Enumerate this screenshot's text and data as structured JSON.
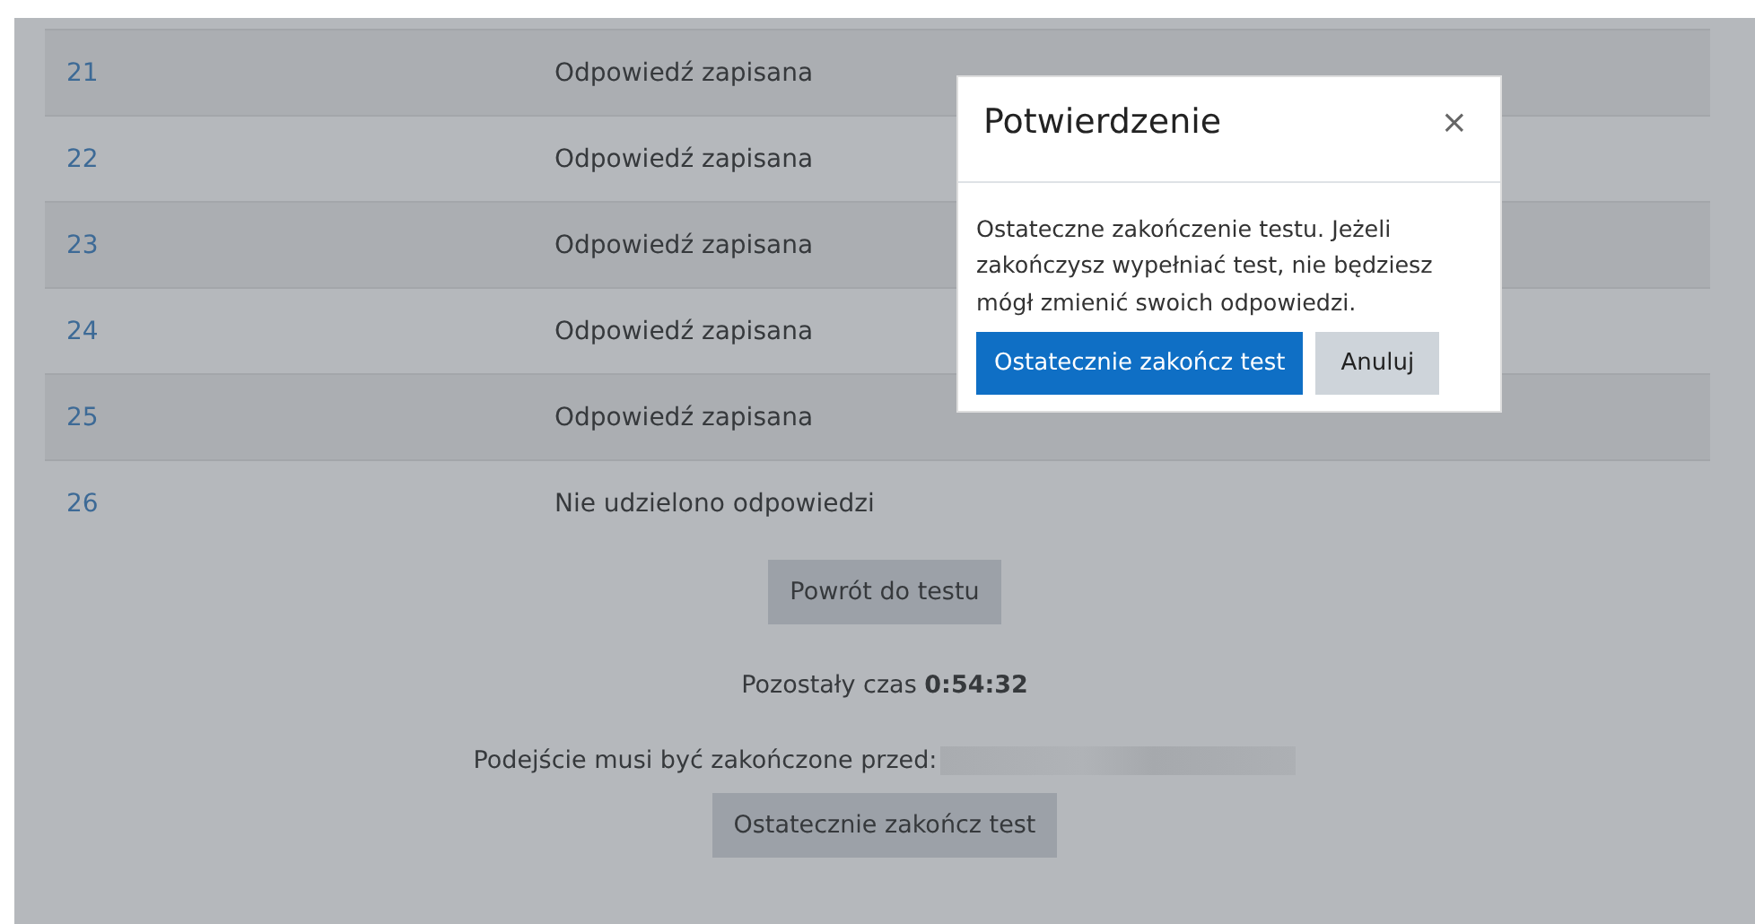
{
  "rows": [
    {
      "number": "21",
      "status": "Odpowiedź zapisana"
    },
    {
      "number": "22",
      "status": "Odpowiedź zapisana"
    },
    {
      "number": "23",
      "status": "Odpowiedź zapisana"
    },
    {
      "number": "24",
      "status": "Odpowiedź zapisana"
    },
    {
      "number": "25",
      "status": "Odpowiedź zapisana"
    },
    {
      "number": "26",
      "status": "Nie udzielono odpowiedzi"
    }
  ],
  "return_button": "Powrót do testu",
  "time_left": "Pozostały czas **0:54:32**",
  "deadline_label": "Podejście musi być zakończone przed:",
  "submit_button": "Ostatecznie zakończ test",
  "dialog": {
    "title": "Potwierdzenie",
    "close": "×",
    "message": "Ostateczne zakończenie testu. Jeżeli zakończysz wypełniać test, nie będziesz mógł zmienić swoich odpowiedzi.",
    "buttons": [
      {
        "label": "Ostatecznie zakończ test",
        "kind": "primary"
      },
      {
        "label": "Anuluj",
        "kind": "secondary"
      }
    ]
  }
}
